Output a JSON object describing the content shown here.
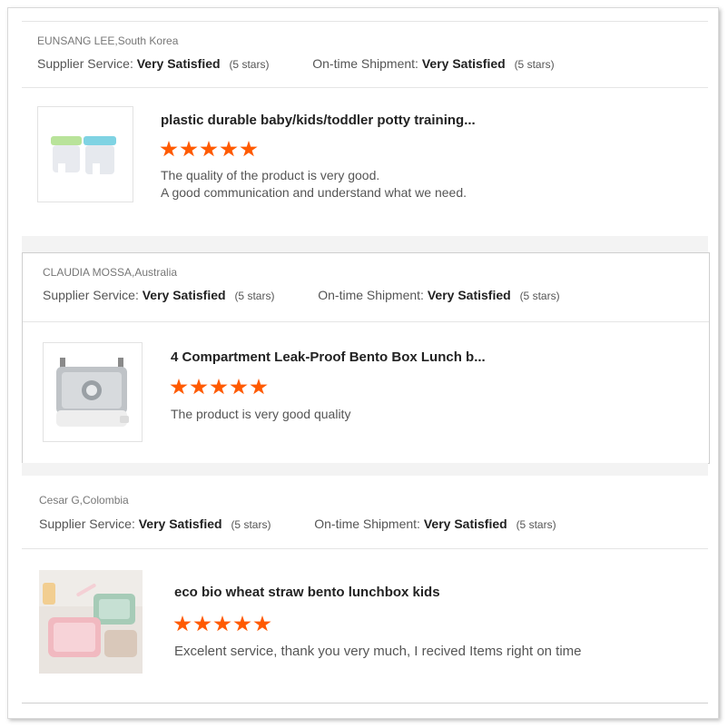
{
  "reviews": [
    {
      "reviewer": "EUNSANG LEE,South Korea",
      "supplier_service_label": "Supplier Service:",
      "supplier_service_value": "Very Satisfied",
      "supplier_service_stars": "(5 stars)",
      "shipment_label": "On-time Shipment:",
      "shipment_value": "Very Satisfied",
      "shipment_stars": "(5 stars)",
      "product_title": "plastic durable baby/kids/toddler potty training...",
      "rating": 5,
      "comment_lines": [
        "The quality of the product is very good.",
        "A good communication and understand what we need."
      ]
    },
    {
      "reviewer": "CLAUDIA MOSSA,Australia",
      "supplier_service_label": "Supplier Service:",
      "supplier_service_value": "Very Satisfied",
      "supplier_service_stars": "(5 stars)",
      "shipment_label": "On-time Shipment:",
      "shipment_value": "Very Satisfied",
      "shipment_stars": "(5 stars)",
      "product_title": "4 Compartment Leak-Proof Bento Box Lunch b...",
      "rating": 5,
      "comment_lines": [
        "The product is very good quality"
      ]
    },
    {
      "reviewer": "Cesar G,Colombia",
      "supplier_service_label": "Supplier Service:",
      "supplier_service_value": "Very Satisfied",
      "supplier_service_stars": "(5 stars)",
      "shipment_label": "On-time Shipment:",
      "shipment_value": "Very Satisfied",
      "shipment_stars": "(5 stars)",
      "product_title": "eco bio wheat straw bento lunchbox kids",
      "rating": 5,
      "comment_lines": [
        "Excelent service, thank you very much, I recived Items right on time"
      ]
    }
  ],
  "colors": {
    "star": "#ff5a00",
    "divider": "#e5e5e5",
    "section_gap": "#f3f3f3"
  },
  "icons": {
    "star": "star-icon"
  }
}
